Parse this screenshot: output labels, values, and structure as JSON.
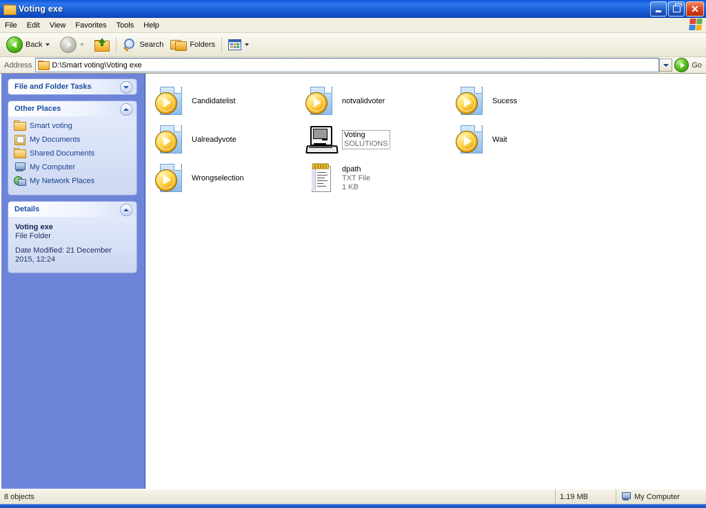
{
  "window": {
    "title": "Voting exe",
    "folder_icon": "folder-icon",
    "minimize_label": "Minimize",
    "maximize_label": "Restore",
    "close_label": "Close"
  },
  "menu": {
    "items": [
      {
        "label": "File"
      },
      {
        "label": "Edit"
      },
      {
        "label": "View"
      },
      {
        "label": "Favorites"
      },
      {
        "label": "Tools"
      },
      {
        "label": "Help"
      }
    ]
  },
  "toolbar": {
    "back_label": "Back",
    "forward_label": "",
    "up_label": "",
    "search_label": "Search",
    "folders_label": "Folders",
    "views_label": ""
  },
  "address": {
    "label": "Address",
    "value": "D:\\Smart voting\\Voting exe",
    "go_label": "Go"
  },
  "sidebar": {
    "panels": [
      {
        "title": "File and Folder Tasks",
        "state": "collapsed",
        "items": []
      },
      {
        "title": "Other Places",
        "state": "expanded",
        "items": [
          {
            "label": "Smart voting",
            "icon": "folder-icon"
          },
          {
            "label": "My Documents",
            "icon": "my-documents-icon"
          },
          {
            "label": "Shared Documents",
            "icon": "folder-icon"
          },
          {
            "label": "My Computer",
            "icon": "my-computer-icon"
          },
          {
            "label": "My Network Places",
            "icon": "network-places-icon"
          }
        ]
      }
    ],
    "details": {
      "title": "Details",
      "state": "expanded",
      "name": "Voting exe",
      "type": "File Folder",
      "date_modified": "Date Modified: 21 December 2015, 12:24"
    }
  },
  "files": [
    {
      "name": "Candidatelist",
      "type_line": "",
      "size_line": "",
      "icon": "media-file-icon",
      "focused": false
    },
    {
      "name": "notvalidvoter",
      "type_line": "",
      "size_line": "",
      "icon": "media-file-icon",
      "focused": false
    },
    {
      "name": "Sucess",
      "type_line": "",
      "size_line": "",
      "icon": "media-file-icon",
      "focused": false
    },
    {
      "name": "Ualreadyvote",
      "type_line": "",
      "size_line": "",
      "icon": "media-file-icon",
      "focused": false
    },
    {
      "name": "Voting",
      "type_line": "SOLUTIONS",
      "size_line": "",
      "icon": "computer-icon",
      "focused": true
    },
    {
      "name": "Wait",
      "type_line": "",
      "size_line": "",
      "icon": "media-file-icon",
      "focused": false
    },
    {
      "name": "Wrongselection",
      "type_line": "",
      "size_line": "",
      "icon": "media-file-icon",
      "focused": false
    },
    {
      "name": "dpath",
      "type_line": "TXT File",
      "size_line": "1 KB",
      "icon": "text-file-icon",
      "focused": false
    }
  ],
  "status": {
    "objects": "8 objects",
    "size": "1.19 MB",
    "location": "My Computer"
  },
  "colors": {
    "title_blue": "#0a56d6",
    "sidebar_blue": "#6d84d8",
    "panel_header_text": "#1c4ea3",
    "link_blue": "#1b3f8f",
    "accent_green": "#2f8a05",
    "close_red": "#e04a20"
  }
}
